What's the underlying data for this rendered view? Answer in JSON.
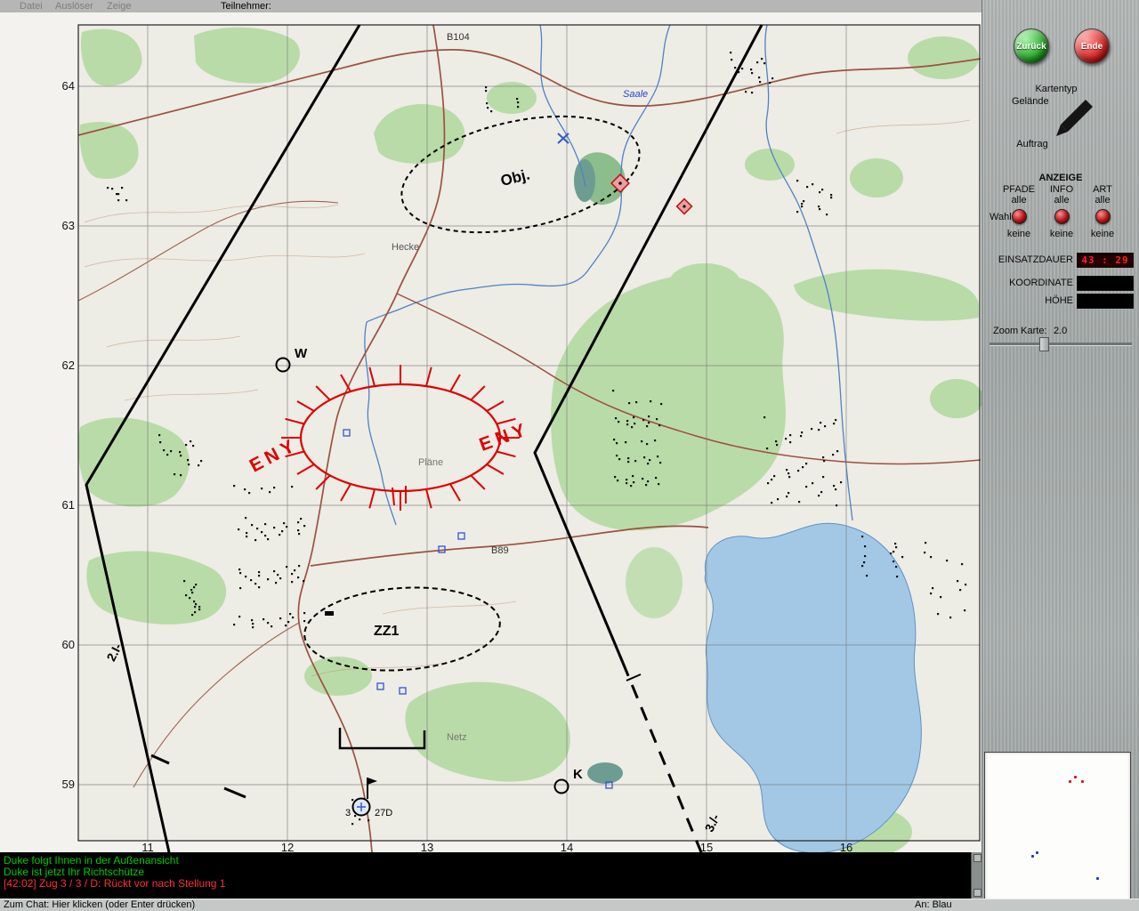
{
  "menu": {
    "items": [
      "Datei",
      "Auslöser",
      "Zeige"
    ],
    "participants_label": "Teilnehmer:"
  },
  "map": {
    "grid": {
      "rows": [
        "64",
        "63",
        "62",
        "61",
        "60",
        "59"
      ],
      "cols": [
        "11",
        "12",
        "13",
        "14",
        "15",
        "16"
      ]
    },
    "places": {
      "road_b104": "B104",
      "river_saale": "Saale",
      "hecke": "Hecke",
      "plaene": "Pläne",
      "road_b89": "B89",
      "netz": "Netz"
    },
    "tactical": {
      "objective": "Obj.",
      "assembly_area": "ZZ1",
      "enemy_west": "ENY",
      "enemy_east": "ENY",
      "waypoint_w": "W",
      "waypoint_k": "K",
      "boundary_south": "2.I-",
      "boundary_east": "3./-",
      "unit_number": "3",
      "unit_name": "27D"
    }
  },
  "panel": {
    "back_button": "Zurück",
    "end_button": "Ende",
    "map_type_label": "Kartentyp",
    "map_type_value": "Gelände",
    "mission_label": "Auftrag",
    "display_label": "ANZEIGE",
    "columns": [
      {
        "title": "PFADE",
        "all": "alle",
        "none": "keine"
      },
      {
        "title": "INFO",
        "all": "alle",
        "none": "keine"
      },
      {
        "title": "ART",
        "all": "alle",
        "none": "keine"
      }
    ],
    "select_label": "Wahl",
    "mission_time_label": "EINSATZDAUER",
    "mission_time_value": "43 : 29",
    "coordinate_label": "KOORDINATE",
    "elevation_label": "HÖHE",
    "zoom_label": "Zoom Karte:",
    "zoom_value": "2.0"
  },
  "chat": {
    "lines": [
      {
        "text": "Duke folgt Ihnen in der Außenansicht",
        "color": "#00cc00"
      },
      {
        "text": "Duke ist jetzt Ihr Richtschütze",
        "color": "#00cc00"
      },
      {
        "text": "[42:02] Zug 3 / 3 / D: Rückt vor nach Stellung 1",
        "color": "#ff3030"
      }
    ]
  },
  "statusbar": {
    "chat_hint": "Zum Chat: Hier klicken (oder Enter drücken)",
    "recipient": "An: Blau"
  },
  "colors": {
    "back_button": "#33bb33",
    "end_button": "#cc2222",
    "led_text": "#ff2222",
    "tactical_red": "#dd0000",
    "tactical_blue": "#3355cc"
  }
}
